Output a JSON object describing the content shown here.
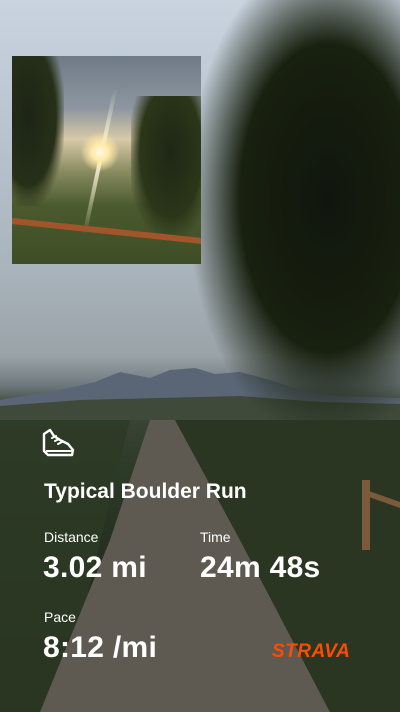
{
  "activity": {
    "title": "Typical Boulder Run"
  },
  "stats": {
    "distance": {
      "label": "Distance",
      "value": "3.02 mi"
    },
    "time": {
      "label": "Time",
      "value": "24m 48s"
    },
    "pace": {
      "label": "Pace",
      "value": "8:12 /mi"
    }
  },
  "brand": {
    "name": "STRAVA",
    "color": "#fc4c02"
  },
  "icons": {
    "activity_type": "running-shoe-icon"
  }
}
